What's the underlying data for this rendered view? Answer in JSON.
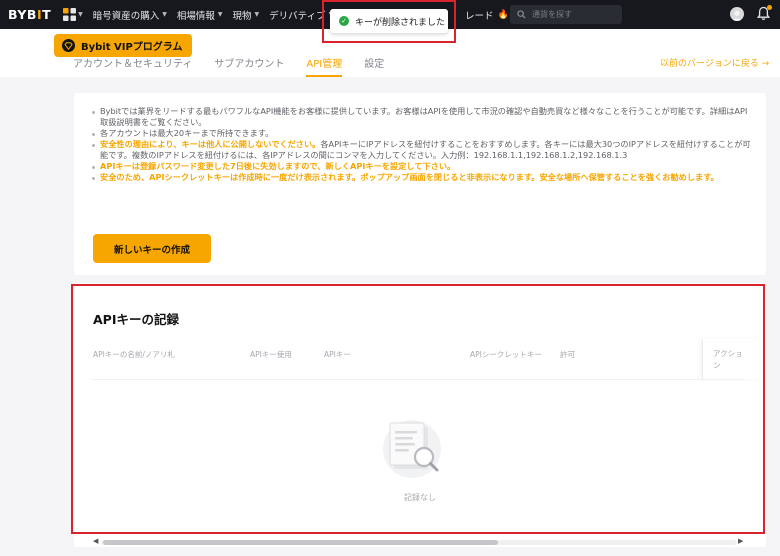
{
  "nav": {
    "logo_pre": "BYB",
    "logo_dot": "I",
    "logo_post": "T",
    "items": [
      {
        "label": "暗号資産の購入",
        "caret": true
      },
      {
        "label": "相場情報",
        "caret": true
      },
      {
        "label": "現物",
        "caret": true
      },
      {
        "label": "デリバティブ",
        "caret": true
      }
    ],
    "trade_label": "レード",
    "search_placeholder": "通貨を探す",
    "icons": [
      "grid-icon",
      "search-icon",
      "avatar-icon",
      "bell-icon",
      "flame-icon"
    ]
  },
  "toast": {
    "message": "キーが削除されました",
    "status_color": "#2aa745"
  },
  "subheader": {
    "vip_label": "Bybit VIPプログラム",
    "tabs": [
      {
        "label": "アカウント＆セキュリティ",
        "active": false
      },
      {
        "label": "サブアカウント",
        "active": false
      },
      {
        "label": "API管理",
        "active": true
      },
      {
        "label": "設定",
        "active": false
      }
    ],
    "back_link": "以前のバージョンに戻る →"
  },
  "info": {
    "note1": "Bybitでは業界をリードする最もパワフルなAPI機能をお客様に提供しています。お客様はAPIを使用して市況の確認や自動売買など様々なことを行うことが可能です。詳細はAPI取扱説明書をご覧ください。",
    "note2": "各アカウントは最大20キーまで所持できます。",
    "note3_hl": "安全性の理由により、キーは他人に公開しないでください。",
    "note3_rest": "各APIキーにIPアドレスを紐付けすることをおすすめします。各キーには最大30つのIPアドレスを紐付けすることが可能です。複数のIPアドレスを紐付けるには、各IPアドレスの間にコンマを入力してください。入力例：192.168.1.1,192.168.1.2,192.168.1.3",
    "note4": "APIキーは登録パスワード変更した7日後に失効しますので、新しくAPIキーを設定して下さい。",
    "note5": "安全のため、APIシークレットキーは作成時に一度だけ表示されます。ポップアップ画面を閉じると非表示になります。安全な場所へ保管することを強くお勧めします。",
    "create_button": "新しいキーの作成"
  },
  "records": {
    "title": "APIキーの記録",
    "columns": [
      "APIキーの名前/ノアリ札",
      "APIキー使用",
      "APIキー",
      "APIシークレットキー",
      "許可"
    ],
    "action_column": "アクション",
    "empty_text": "記録なし"
  },
  "colors": {
    "accent": "#f7a600",
    "nav_bg": "#17181e",
    "highlight_frame": "#d9232d"
  }
}
